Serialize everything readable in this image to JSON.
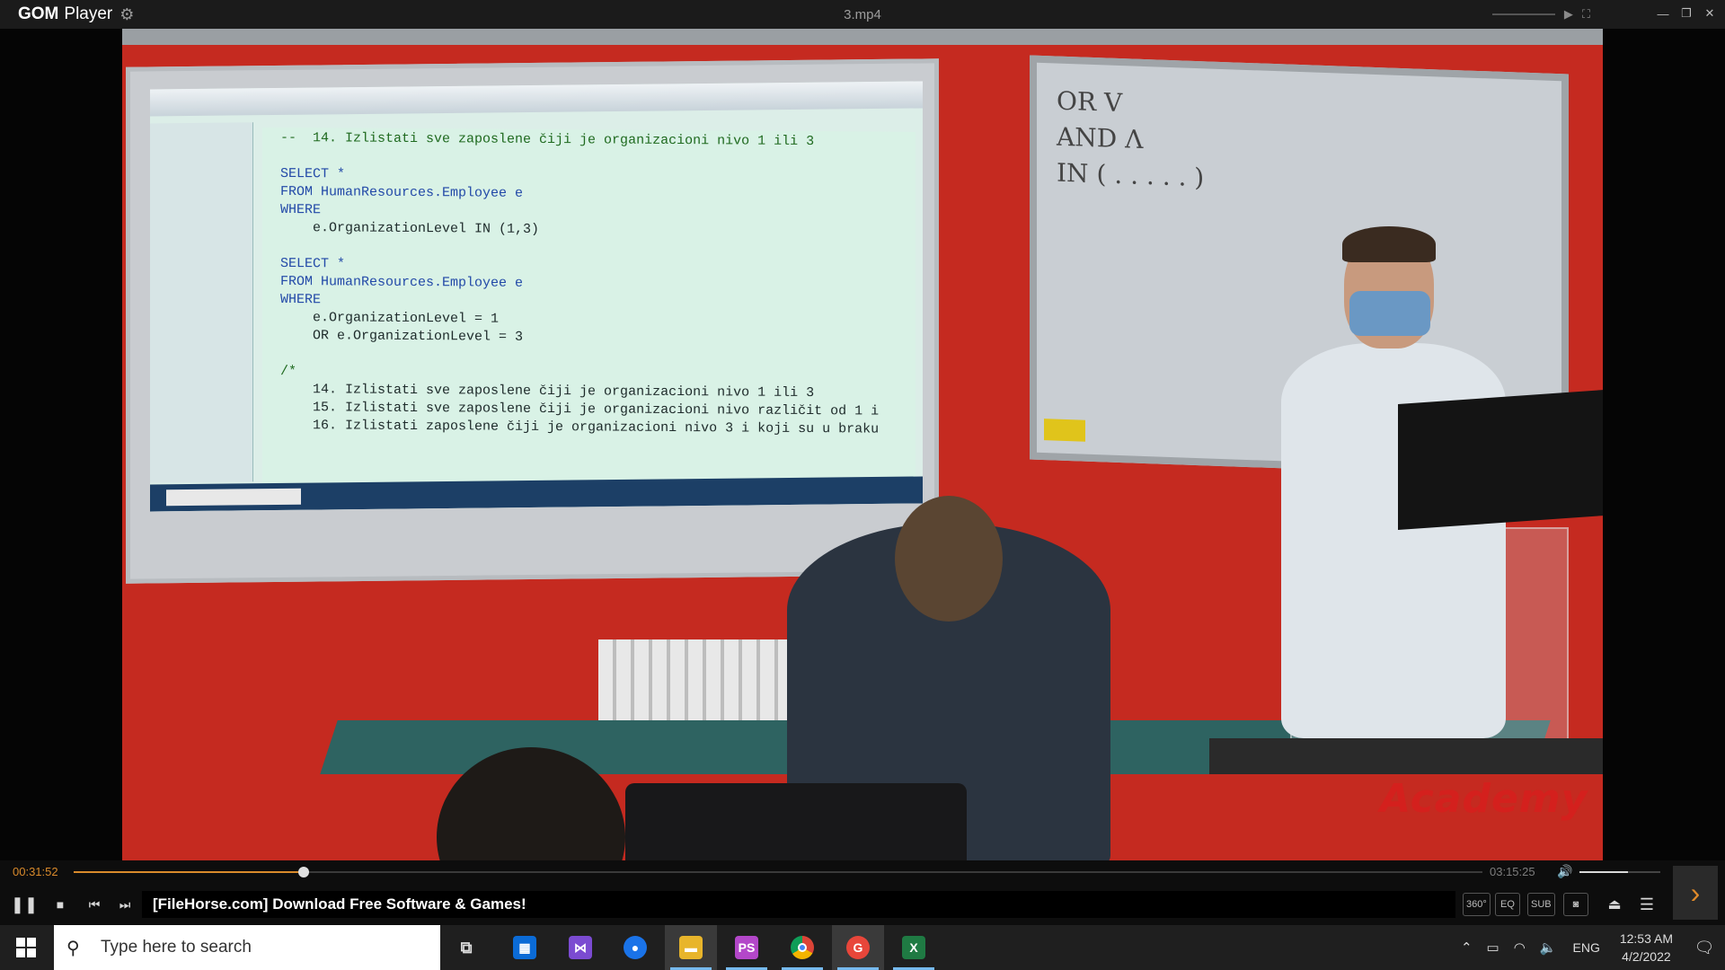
{
  "app": {
    "name_left": "GOM",
    "name_right": "Player",
    "window_title": "3.mp4"
  },
  "video": {
    "whiteboard_lines": [
      "OR  V",
      "AND  Λ",
      "IN  ( . . . . . )"
    ],
    "watermark": "Academy",
    "code_lines": [
      "--  14. Izlistati sve zaposlene čiji je organizacioni nivo 1 ili 3",
      "",
      "SELECT *",
      "FROM HumanResources.Employee e",
      "WHERE",
      "    e.OrganizationLevel IN (1,3)",
      "",
      "SELECT *",
      "FROM HumanResources.Employee e",
      "WHERE",
      "    e.OrganizationLevel = 1",
      "    OR e.OrganizationLevel = 3",
      "",
      "/*",
      "    14. Izlistati sve zaposlene čiji je organizacioni nivo 1 ili 3",
      "    15. Izlistati sve zaposlene čiji je organizacioni nivo različit od 1 i",
      "    16. Izlistati zaposlene čiji je organizacioni nivo 3 i koji su u braku"
    ]
  },
  "playback": {
    "elapsed": "00:31:52",
    "total": "03:15:25",
    "progress": 0.163,
    "volume": 0.6,
    "banner": "[FileHorse.com] Download Free Software & Games!"
  },
  "controls": {
    "right_buttons": [
      "360°",
      "EQ",
      "SUB",
      "camera-icon",
      "eject-icon",
      "menu-icon"
    ]
  },
  "taskbar": {
    "search_placeholder": "Type here to search",
    "language": "ENG",
    "time": "12:53 AM",
    "date": "4/2/2022"
  },
  "colors": {
    "accent": "#d98a2b",
    "taskbar": "#1f1f1f"
  }
}
